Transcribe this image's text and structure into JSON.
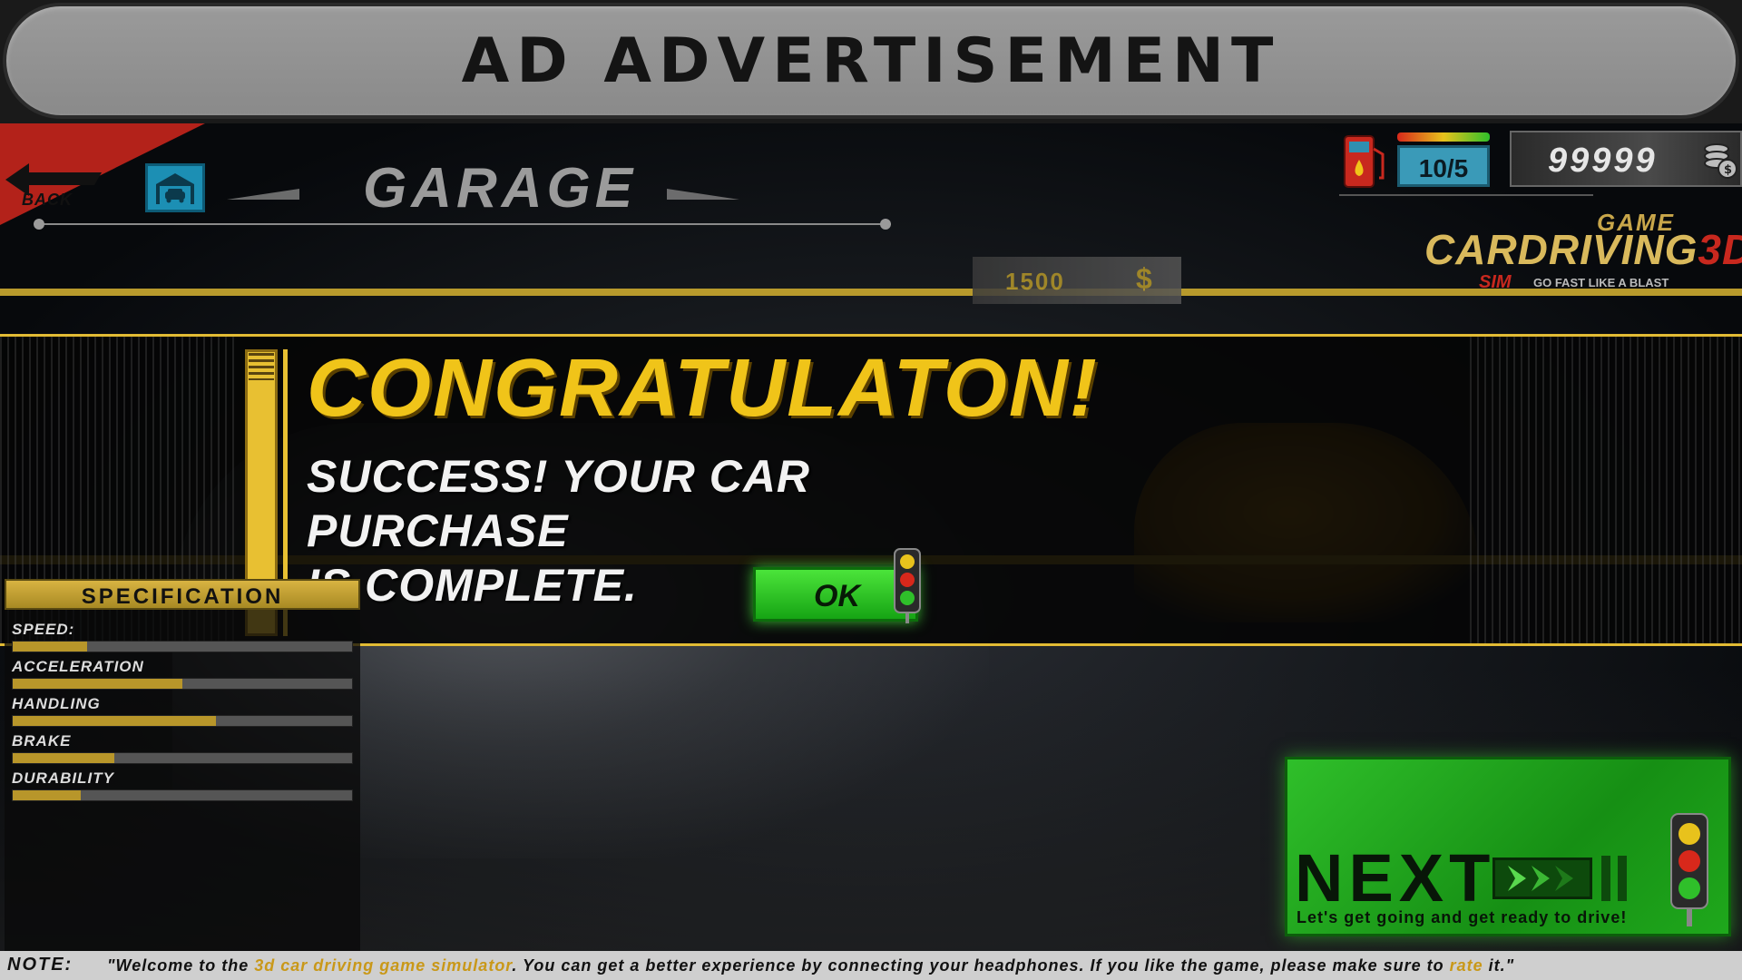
{
  "ad": {
    "title": "AD ADVERTISEMENT"
  },
  "header": {
    "back_label": "BACK",
    "title": "GARAGE",
    "fuel": "10/5",
    "coins": "99999"
  },
  "logo": {
    "game": "GAME",
    "car": "C",
    "driving": "ARDRIVING",
    "three_d": "3D",
    "sim": "SIM",
    "tagline": "GO FAST LIKE A BLAST"
  },
  "car_price": {
    "value": "1500",
    "currency": "$"
  },
  "modal": {
    "title": "CONGRATULATON!",
    "line1": "SUCCESS! YOUR CAR PURCHASE",
    "line2": "IS COMPLETE.",
    "ok_label": "OK"
  },
  "specification": {
    "title": "SPECIFICATION",
    "stats": [
      {
        "label": "SPEED:",
        "value": 0.22
      },
      {
        "label": "ACCELERATION",
        "value": 0.5
      },
      {
        "label": "HANDLING",
        "value": 0.6
      },
      {
        "label": "BRAKE",
        "value": 0.3
      },
      {
        "label": "DURABILITY",
        "value": 0.2
      }
    ]
  },
  "next": {
    "label": "NEXT",
    "subtitle": "Let's get going and get ready to drive!"
  },
  "note": {
    "label": "NOTE:",
    "pre": "\"Welcome to the ",
    "highlight1": "3d car driving game simulator",
    "mid": ". You can get a better experience by connecting your headphones. If you like the game, please make sure to ",
    "highlight2": "rate",
    "post": " it.\""
  },
  "colors": {
    "gold": "#e2bb34",
    "green": "#2fbf2a",
    "back_red": "#b3221a",
    "garage_blue": "#1c8fb4"
  }
}
